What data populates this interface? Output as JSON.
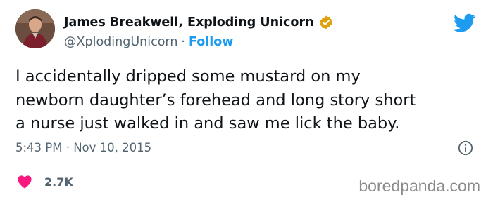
{
  "author": {
    "name": "James Breakwell, Exploding Unicorn",
    "handle": "@XplodingUnicorn",
    "separator": "·",
    "follow_label": "Follow",
    "verified_badge_color": "#e0a10e"
  },
  "tweet": {
    "text_lines": [
      "I accidentally dripped some mustard on my",
      "newborn daughter’s forehead and long story short",
      "a nurse just walked in and saw me lick the baby."
    ],
    "timestamp": "5:43 PM · Nov 10, 2015"
  },
  "engagement": {
    "like_count": "2.7K",
    "like_icon": "heart-icon",
    "heart_color": "#f91880"
  },
  "icons": {
    "brand": "twitter-logo-icon",
    "info": "info-icon",
    "verified": "verified-badge-icon"
  },
  "colors": {
    "link": "#1d9bf0",
    "secondary_text": "#536471",
    "twitter_blue": "#1d9bf0"
  },
  "watermark": "boredpanda.com"
}
